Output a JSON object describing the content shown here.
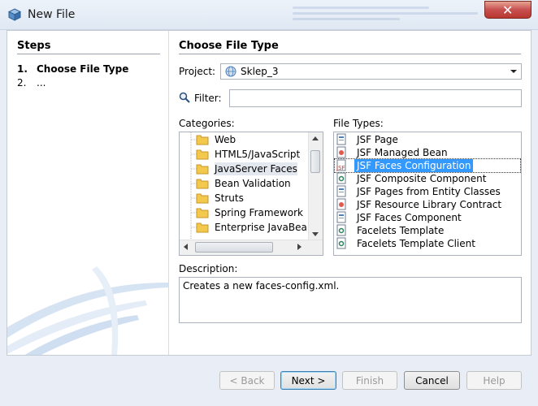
{
  "window": {
    "title": "New File",
    "close_glyph": "✕"
  },
  "steps": {
    "heading": "Steps",
    "items": [
      {
        "num": "1.",
        "label": "Choose File Type"
      },
      {
        "num": "2.",
        "label": "..."
      }
    ]
  },
  "main": {
    "heading": "Choose File Type",
    "project": {
      "label": "Project:",
      "value": "Sklep_3"
    },
    "filter": {
      "label": "Filter:",
      "value": ""
    },
    "categories": {
      "label": "Categories:",
      "selected": "JavaServer Faces",
      "items": [
        {
          "label": "Web",
          "icon": "folder-icon"
        },
        {
          "label": "HTML5/JavaScript",
          "icon": "folder-icon"
        },
        {
          "label": "JavaServer Faces",
          "icon": "folder-icon"
        },
        {
          "label": "Bean Validation",
          "icon": "folder-icon"
        },
        {
          "label": "Struts",
          "icon": "folder-icon"
        },
        {
          "label": "Spring Framework",
          "icon": "folder-icon"
        },
        {
          "label": "Enterprise JavaBean",
          "icon": "folder-icon"
        }
      ]
    },
    "file_types": {
      "label": "File Types:",
      "selected": "JSF Faces Configuration",
      "items": [
        {
          "label": "JSF Page",
          "icon": "jsf-page-icon"
        },
        {
          "label": "JSF Managed Bean",
          "icon": "managed-bean-icon"
        },
        {
          "label": "JSF Faces Configuration",
          "icon": "faces-config-icon"
        },
        {
          "label": "JSF Composite Component",
          "icon": "composite-component-icon"
        },
        {
          "label": "JSF Pages from Entity Classes",
          "icon": "jsf-page-icon"
        },
        {
          "label": "JSF Resource Library Contract",
          "icon": "managed-bean-icon"
        },
        {
          "label": "JSF Faces Component",
          "icon": "jsf-page-icon"
        },
        {
          "label": "Facelets Template",
          "icon": "composite-component-icon"
        },
        {
          "label": "Facelets Template Client",
          "icon": "composite-component-icon"
        }
      ]
    },
    "description": {
      "label": "Description:",
      "text": "Creates a new faces-config.xml."
    }
  },
  "buttons": {
    "back": "< Back",
    "next": "Next >",
    "finish": "Finish",
    "cancel": "Cancel",
    "help": "Help"
  },
  "colors": {
    "selection": "#3399ff",
    "close_button": "#c75050"
  }
}
